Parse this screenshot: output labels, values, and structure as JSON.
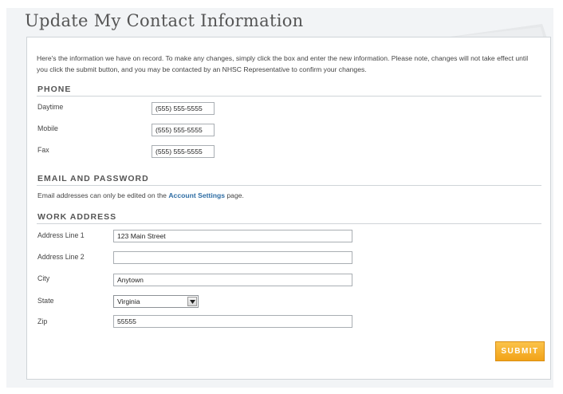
{
  "page": {
    "title": "Update My Contact Information",
    "intro": "Here's the information we have on record. To make any changes, simply click the box and enter the new information. Please note, changes will not take effect until you click the submit button, and you may be contacted by an NHSC Representative to confirm your changes."
  },
  "phone": {
    "heading": "PHONE",
    "daytime": {
      "label": "Daytime",
      "value": "(555) 555-5555"
    },
    "mobile": {
      "label": "Mobile",
      "value": "(555) 555-5555"
    },
    "fax": {
      "label": "Fax",
      "value": "(555) 555-5555"
    }
  },
  "email": {
    "heading": "EMAIL AND PASSWORD",
    "note_before": "Email addresses can only be edited on the ",
    "link": "Account Settings",
    "note_after": " page.",
    "link_color": "#2e6da4"
  },
  "address": {
    "heading": "WORK ADDRESS",
    "line1": {
      "label": "Address Line 1",
      "value": "123 Main Street"
    },
    "line2": {
      "label": "Address Line 2",
      "value": ""
    },
    "city": {
      "label": "City",
      "value": "Anytown"
    },
    "state": {
      "label": "State",
      "value": "Virginia"
    },
    "zip": {
      "label": "Zip",
      "value": "55555"
    }
  },
  "actions": {
    "submit_label": "SUBMIT",
    "submit_color": "#f2a318"
  },
  "icons": {
    "dropdown": "chevron-down-icon",
    "decoration": "paper-stack-icon"
  }
}
